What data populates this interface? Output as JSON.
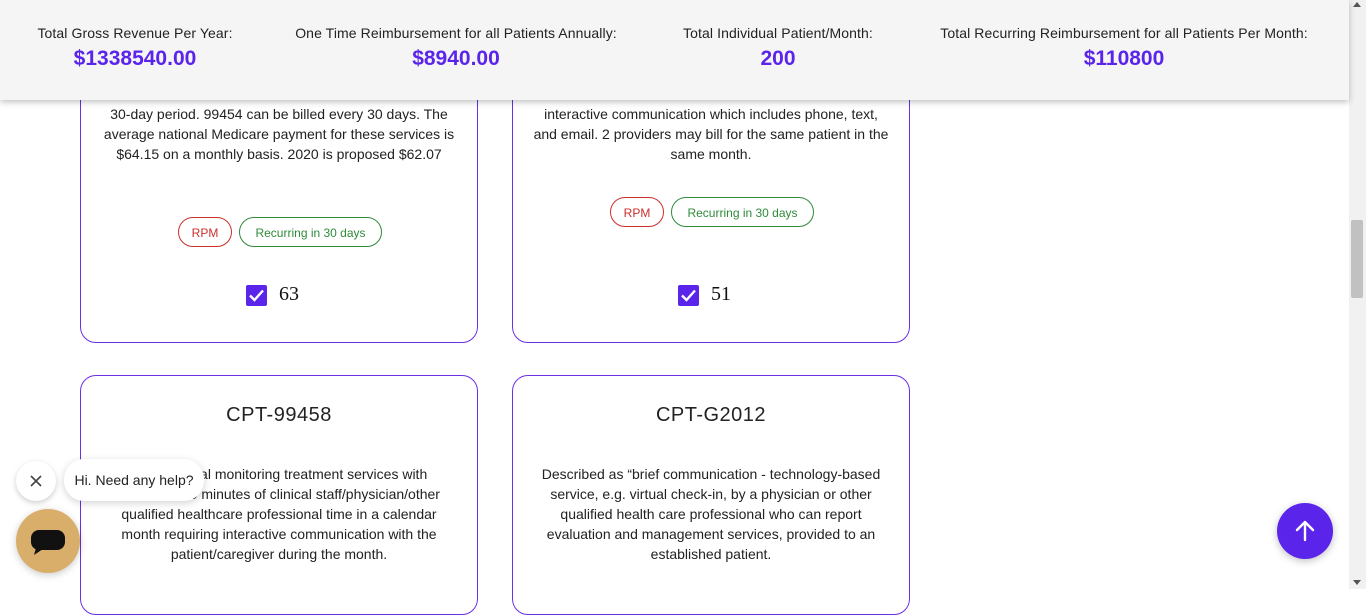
{
  "stats": {
    "gross_revenue_label": "Total Gross Revenue Per Year:",
    "gross_revenue_value": "$1338540.00",
    "one_time_label": "One Time Reimbursement for all Patients Annually:",
    "one_time_value": "$8940.00",
    "patients_label": "Total Individual Patient/Month:",
    "patients_value": "200",
    "recurring_label": "Total Recurring Reimbursement for all Patients Per Month:",
    "recurring_value": "$110800"
  },
  "cards": [
    {
      "desc": "30-day period. 99454 can be billed every 30 days. The average national Medicare payment for these services is $64.15 on a monthly basis. 2020 is proposed $62.07",
      "tag1": "RPM",
      "tag2": "Recurring in 30 days",
      "count": "63"
    },
    {
      "desc": "interactive communication which includes phone, text, and email. 2 providers may bill for the same patient in the same month.",
      "tag1": "RPM",
      "tag2": "Recurring in 30 days",
      "count": "51"
    },
    {
      "title": "CPT-99458",
      "desc": "physiological monitoring treatment services with additional 20 minutes of clinical staff/physician/other qualified healthcare professional time in a calendar month requiring interactive communication with the patient/caregiver during the month."
    },
    {
      "title": "CPT-G2012",
      "desc": "Described as “brief communication - technology-based service, e.g. virtual check-in, by a physician or other qualified health care professional who can report evaluation and management services, provided to an established patient."
    }
  ],
  "chat": {
    "greeting": "Hi. Need any help?"
  },
  "colors": {
    "accent": "#5b24ea",
    "chat_button": "#d9ae6b",
    "tag_red": "#c9302c",
    "tag_green": "#2e8b3a"
  },
  "icons": [
    "close-icon",
    "chat-icon",
    "arrow-up-icon",
    "checkbox-checked-icon"
  ]
}
